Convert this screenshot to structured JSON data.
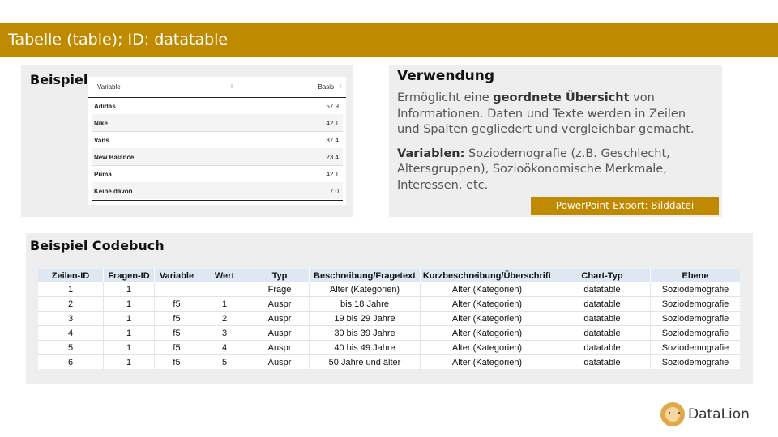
{
  "header": {
    "title": "Tabelle (table); ID: datatable"
  },
  "example": {
    "heading": "Beispiel",
    "table": {
      "col_variable": "Variable",
      "col_basis": "Basis",
      "rows": [
        {
          "name": "Adidas",
          "value": "57.9"
        },
        {
          "name": "Nike",
          "value": "42.1"
        },
        {
          "name": "Vans",
          "value": "37.4"
        },
        {
          "name": "New Balance",
          "value": "23.4"
        },
        {
          "name": "Puma",
          "value": "42.1"
        },
        {
          "name": "Keine davon",
          "value": "7.0"
        }
      ]
    }
  },
  "usage": {
    "heading": "Verwendung",
    "p1_pre": "Ermöglicht eine ",
    "p1_bold": "geordnete Übersicht",
    "p1_post": " von Informationen. Daten und Texte werden in Zeilen und Spalten gegliedert und vergleichbar gemacht.",
    "p2_bold": "Variablen:",
    "p2_post": " Soziodemografie (z.B. Geschlecht, Altersgruppen), Sozioökonomische Merkmale, Interessen, etc.",
    "export_badge": "PowerPoint-Export: Bilddatei"
  },
  "codebook": {
    "heading": "Beispiel Codebuch",
    "columns": [
      "Zeilen-ID",
      "Fragen-ID",
      "Variable",
      "Wert",
      "Typ",
      "Beschreibung/Fragetext",
      "Kurzbeschreibung/Überschrift",
      "Chart-Typ",
      "Ebene"
    ],
    "rows": [
      [
        "1",
        "1",
        "",
        "",
        "Frage",
        "Alter (Kategorien)",
        "Alter (Kategorien)",
        "datatable",
        "Soziodemografie"
      ],
      [
        "2",
        "1",
        "f5",
        "1",
        "Auspr",
        "bis 18 Jahre",
        "Alter (Kategorien)",
        "datatable",
        "Soziodemografie"
      ],
      [
        "3",
        "1",
        "f5",
        "2",
        "Auspr",
        "19 bis 29 Jahre",
        "Alter (Kategorien)",
        "datatable",
        "Soziodemografie"
      ],
      [
        "4",
        "1",
        "f5",
        "3",
        "Auspr",
        "30 bis 39 Jahre",
        "Alter (Kategorien)",
        "datatable",
        "Soziodemografie"
      ],
      [
        "5",
        "1",
        "f5",
        "4",
        "Auspr",
        "40 bis 49 Jahre",
        "Alter (Kategorien)",
        "datatable",
        "Soziodemografie"
      ],
      [
        "6",
        "1",
        "f5",
        "5",
        "Auspr",
        "50 Jahre und älter",
        "Alter (Kategorien)",
        "datatable",
        "Soziodemografie"
      ]
    ]
  },
  "brand": {
    "name": "DataLion",
    "accent": "#c08a00"
  }
}
